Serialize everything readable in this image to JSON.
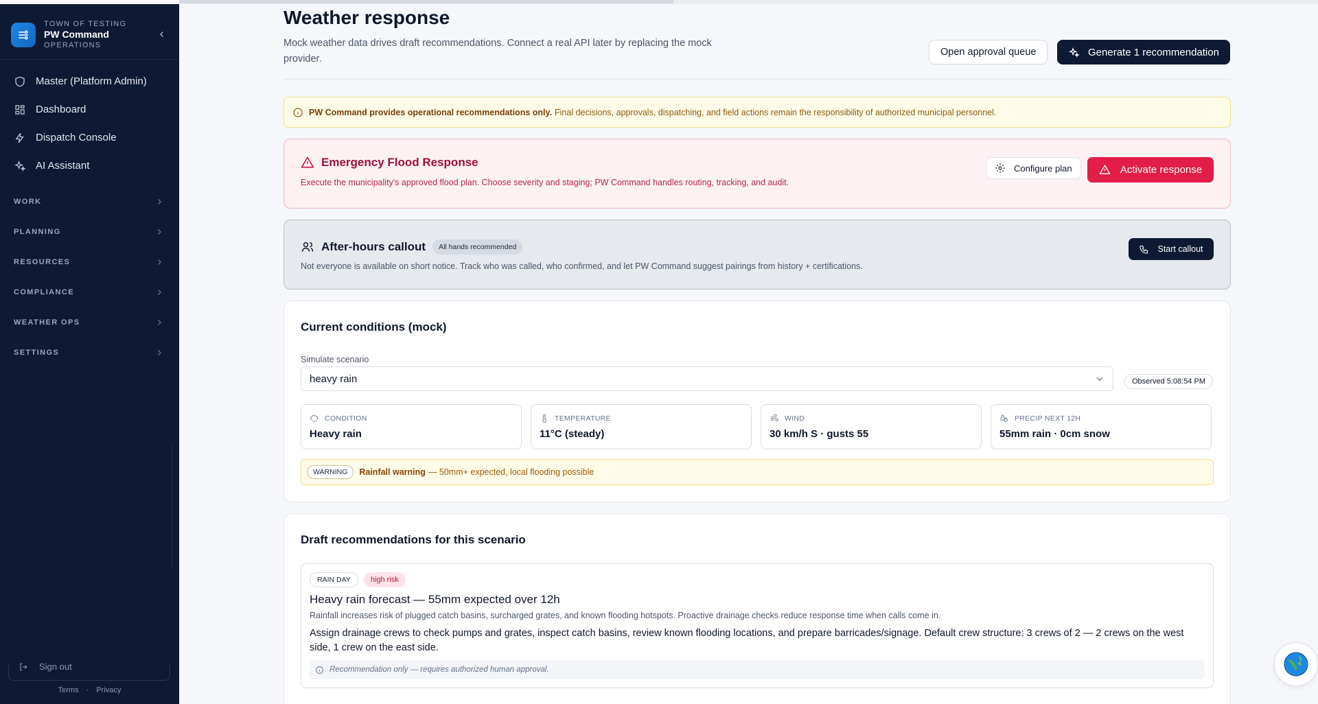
{
  "brand": {
    "town": "TOWN OF TESTING",
    "name": "PW Command",
    "sub": "OPERATIONS"
  },
  "nav": {
    "items": [
      {
        "label": "Master (Platform Admin)",
        "icon": "shield-icon"
      },
      {
        "label": "Dashboard",
        "icon": "grid-icon"
      },
      {
        "label": "Dispatch Console",
        "icon": "bolt-icon"
      },
      {
        "label": "AI Assistant",
        "icon": "sparkles-icon"
      }
    ],
    "groups": [
      "WORK",
      "PLANNING",
      "RESOURCES",
      "COMPLIANCE",
      "WEATHER OPS",
      "SETTINGS"
    ]
  },
  "footer": {
    "signout": "Sign out",
    "terms": "Terms",
    "privacy": "Privacy"
  },
  "header": {
    "title": "Weather response",
    "description": "Mock weather data drives draft recommendations. Connect a real API later by replacing the mock provider.",
    "approval_button": "Open approval queue",
    "generate_button": "Generate 1 recommendation"
  },
  "notice": {
    "bold": "PW Command provides operational recommendations only.",
    "text": "Final decisions, approvals, dispatching, and field actions remain the responsibility of authorized municipal personnel."
  },
  "flood": {
    "title": "Emergency Flood Response",
    "description": "Execute the municipality's approved flood plan. Choose severity and staging; PW Command handles routing, tracking, and audit.",
    "configure_button": "Configure plan",
    "activate_button": "Activate response"
  },
  "callout": {
    "title": "After-hours callout",
    "badge": "All hands recommended",
    "description": "Not everyone is available on short notice. Track who was called, who confirmed, and let PW Command suggest pairings from history + certifications.",
    "button": "Start callout"
  },
  "conditions": {
    "title": "Current conditions (mock)",
    "scenario_label": "Simulate scenario",
    "scenario_value": "heavy rain",
    "observed": "Observed 5:08:54 PM",
    "metrics": [
      {
        "label": "CONDITION",
        "value": "Heavy rain",
        "icon": "cloud-rain-icon"
      },
      {
        "label": "TEMPERATURE",
        "value": "11°C (steady)",
        "icon": "thermometer-icon"
      },
      {
        "label": "WIND",
        "value": "30 km/h S · gusts 55",
        "icon": "wind-icon"
      },
      {
        "label": "PRECIP NEXT 12H",
        "value": "55mm rain · 0cm snow",
        "icon": "droplets-icon"
      }
    ],
    "warning": {
      "badge": "WARNING",
      "bold": "Rainfall warning",
      "text": "— 50mm+ expected, local flooding possible"
    }
  },
  "drafts": {
    "title": "Draft recommendations for this scenario",
    "recommendation": {
      "tag": "RAIN DAY",
      "risk": "high risk",
      "title": "Heavy rain forecast — 55mm expected over 12h",
      "description": "Rainfall increases risk of plugged catch basins, surcharged grates, and known flooding hotspots. Proactive drainage checks reduce response time when calls come in.",
      "body": "Assign drainage crews to check pumps and grates, inspect catch basins, review known flooding locations, and prepare barricades/signage. Default crew structure: 3 crews of 2 — 2 crews on the west side, 1 crew on the east side.",
      "note": "Recommendation only — requires authorized human approval."
    }
  }
}
